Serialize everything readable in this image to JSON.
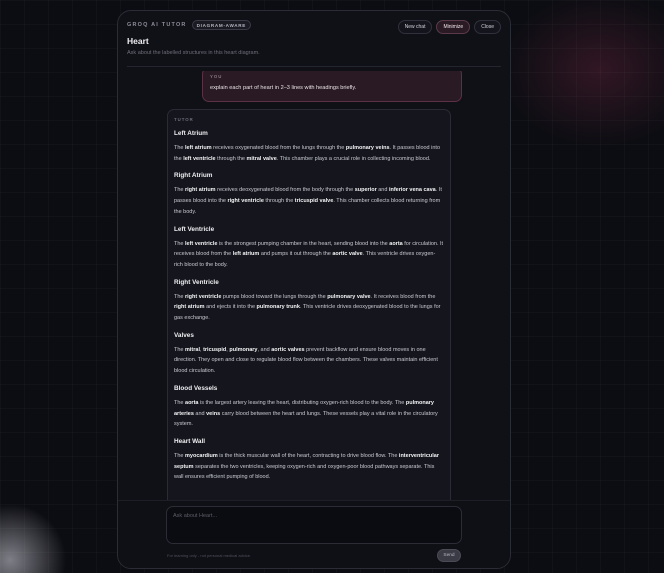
{
  "header": {
    "brand": "GROQ AI TUTOR",
    "badge": "DIAGRAM-AWARE",
    "title": "Heart",
    "subtitle": "Ask about the labelled structures in this heart diagram.",
    "buttons": {
      "new_chat": "New chat",
      "minimize": "Minimize",
      "close": "Close"
    }
  },
  "conversation": {
    "user": {
      "role": "YOU",
      "text": "explain each part of heart in 2–3 lines with headings briefly."
    },
    "tutor": {
      "role": "TUTOR",
      "sections": [
        {
          "heading": "Left Atrium",
          "parts": [
            {
              "t": "The ",
              "b": false
            },
            {
              "t": "left atrium",
              "b": true
            },
            {
              "t": " receives oxygenated blood from the lungs through the ",
              "b": false
            },
            {
              "t": "pulmonary veins",
              "b": true
            },
            {
              "t": ". It passes blood into the ",
              "b": false
            },
            {
              "t": "left ventricle",
              "b": true
            },
            {
              "t": " through the ",
              "b": false
            },
            {
              "t": "mitral valve",
              "b": true
            },
            {
              "t": ". This chamber plays a crucial role in collecting incoming blood.",
              "b": false
            }
          ]
        },
        {
          "heading": "Right Atrium",
          "parts": [
            {
              "t": "The ",
              "b": false
            },
            {
              "t": "right atrium",
              "b": true
            },
            {
              "t": " receives deoxygenated blood from the body through the ",
              "b": false
            },
            {
              "t": "superior",
              "b": true
            },
            {
              "t": " and ",
              "b": false
            },
            {
              "t": "inferior vena cava",
              "b": true
            },
            {
              "t": ". It passes blood into the ",
              "b": false
            },
            {
              "t": "right ventricle",
              "b": true
            },
            {
              "t": " through the ",
              "b": false
            },
            {
              "t": "tricuspid valve",
              "b": true
            },
            {
              "t": ". This chamber collects blood returning from the body.",
              "b": false
            }
          ]
        },
        {
          "heading": "Left Ventricle",
          "parts": [
            {
              "t": "The ",
              "b": false
            },
            {
              "t": "left ventricle",
              "b": true
            },
            {
              "t": " is the strongest pumping chamber in the heart, sending blood into the ",
              "b": false
            },
            {
              "t": "aorta",
              "b": true
            },
            {
              "t": " for circulation. It receives blood from the ",
              "b": false
            },
            {
              "t": "left atrium",
              "b": true
            },
            {
              "t": " and pumps it out through the ",
              "b": false
            },
            {
              "t": "aortic valve",
              "b": true
            },
            {
              "t": ". This ventricle drives oxygen-rich blood to the body.",
              "b": false
            }
          ]
        },
        {
          "heading": "Right Ventricle",
          "parts": [
            {
              "t": "The ",
              "b": false
            },
            {
              "t": "right ventricle",
              "b": true
            },
            {
              "t": " pumps blood toward the lungs through the ",
              "b": false
            },
            {
              "t": "pulmonary valve",
              "b": true
            },
            {
              "t": ". It receives blood from the ",
              "b": false
            },
            {
              "t": "right atrium",
              "b": true
            },
            {
              "t": " and ejects it into the ",
              "b": false
            },
            {
              "t": "pulmonary trunk",
              "b": true
            },
            {
              "t": ". This ventricle drives deoxygenated blood to the lungs for gas exchange.",
              "b": false
            }
          ]
        },
        {
          "heading": "Valves",
          "parts": [
            {
              "t": "The ",
              "b": false
            },
            {
              "t": "mitral",
              "b": true
            },
            {
              "t": ", ",
              "b": false
            },
            {
              "t": "tricuspid",
              "b": true
            },
            {
              "t": ", ",
              "b": false
            },
            {
              "t": "pulmonary",
              "b": true
            },
            {
              "t": ", and ",
              "b": false
            },
            {
              "t": "aortic valves",
              "b": true
            },
            {
              "t": " prevent backflow and ensure blood moves in one direction. They open and close to regulate blood flow between the chambers. These valves maintain efficient blood circulation.",
              "b": false
            }
          ]
        },
        {
          "heading": "Blood Vessels",
          "parts": [
            {
              "t": "The ",
              "b": false
            },
            {
              "t": "aorta",
              "b": true
            },
            {
              "t": " is the largest artery leaving the heart, distributing oxygen-rich blood to the body. The ",
              "b": false
            },
            {
              "t": "pulmonary arteries",
              "b": true
            },
            {
              "t": " and ",
              "b": false
            },
            {
              "t": "veins",
              "b": true
            },
            {
              "t": " carry blood between the heart and lungs. These vessels play a vital role in the circulatory system.",
              "b": false
            }
          ]
        },
        {
          "heading": "Heart Wall",
          "parts": [
            {
              "t": "The ",
              "b": false
            },
            {
              "t": "myocardium",
              "b": true
            },
            {
              "t": " is the thick muscular wall of the heart, contracting to drive blood flow. The ",
              "b": false
            },
            {
              "t": "interventricular septum",
              "b": true
            },
            {
              "t": " separates the two ventricles, keeping oxygen-rich and oxygen-poor blood pathways separate. This wall ensures efficient pumping of blood.",
              "b": false
            }
          ]
        }
      ]
    }
  },
  "composer": {
    "placeholder": "Ask about Heart...",
    "footnote": "For learning only - not personal medical advice.",
    "send_label": "Send"
  }
}
